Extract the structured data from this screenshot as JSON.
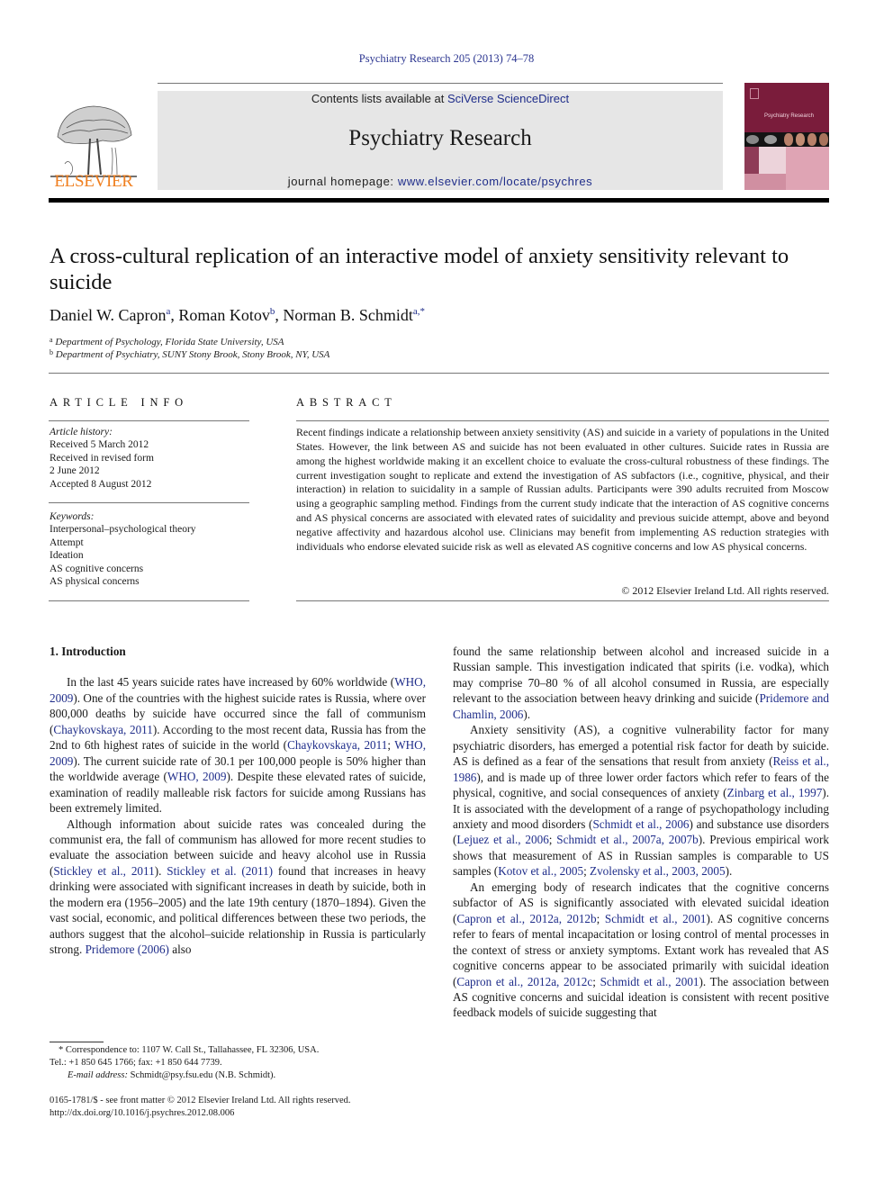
{
  "journal_ref": "Psychiatry Research 205 (2013) 74–78",
  "header": {
    "publisher_logo_text": "ELSEVIER",
    "contents_prefix": "Contents lists available at ",
    "contents_link": "SciVerse ScienceDirect",
    "journal_name": "Psychiatry Research",
    "homepage_prefix": "journal homepage: ",
    "homepage_link": "www.elsevier.com/locate/psychres",
    "cover_title": "Psychiatry Research",
    "colors": {
      "elsevier_orange": "#f07f1f",
      "banner_gray": "#e6e6e6",
      "cover_maroon": "#7a1c3b",
      "link_blue": "#1f2d8a"
    }
  },
  "article": {
    "title": "A cross-cultural replication of an interactive model of anxiety sensitivity relevant to suicide",
    "authors": [
      {
        "name": "Daniel W. Capron",
        "sup": "a"
      },
      {
        "name": "Roman Kotov",
        "sup": "b"
      },
      {
        "name": "Norman B. Schmidt",
        "sup": "a,*"
      }
    ],
    "affiliations": [
      {
        "sup": "a",
        "text": "Department of Psychology, Florida State University, USA"
      },
      {
        "sup": "b",
        "text": "Department of Psychiatry, SUNY Stony Brook, Stony Brook, NY, USA"
      }
    ]
  },
  "article_info": {
    "heading": "ARTICLE INFO",
    "history_label": "Article history:",
    "history": [
      "Received 5 March 2012",
      "Received in revised form",
      "2 June 2012",
      "Accepted 8 August 2012"
    ],
    "keywords_label": "Keywords:",
    "keywords": [
      "Interpersonal–psychological theory",
      "Attempt",
      "Ideation",
      "AS cognitive concerns",
      "AS physical concerns"
    ]
  },
  "abstract": {
    "heading": "ABSTRACT",
    "text": "Recent findings indicate a relationship between anxiety sensitivity (AS) and suicide in a variety of populations in the United States. However, the link between AS and suicide has not been evaluated in other cultures. Suicide rates in Russia are among the highest worldwide making it an excellent choice to evaluate the cross-cultural robustness of these findings. The current investigation sought to replicate and extend the investigation of AS subfactors (i.e., cognitive, physical, and their interaction) in relation to suicidality in a sample of Russian adults. Participants were 390 adults recruited from Moscow using a geographic sampling method. Findings from the current study indicate that the interaction of AS cognitive concerns and AS physical concerns are associated with elevated rates of suicidality and previous suicide attempt, above and beyond negative affectivity and hazardous alcohol use. Clinicians may benefit from implementing AS reduction strategies with individuals who endorse elevated suicide risk as well as elevated AS cognitive concerns and low AS physical concerns.",
    "copyright": "© 2012 Elsevier Ireland Ltd. All rights reserved."
  },
  "body": {
    "section_heading": "1.  Introduction",
    "left_paragraphs": [
      [
        {
          "t": "In the last 45 years suicide rates have increased by 60% worldwide ("
        },
        {
          "t": "WHO, 2009",
          "link": true
        },
        {
          "t": "). One of the countries with the highest suicide rates is Russia, where over 800,000 deaths by suicide have occurred since the fall of communism ("
        },
        {
          "t": "Chaykovskaya, 2011",
          "link": true
        },
        {
          "t": "). According to the most recent data, Russia has from the 2nd to 6th highest rates of suicide in the world ("
        },
        {
          "t": "Chaykovskaya, 2011",
          "link": true
        },
        {
          "t": "; "
        },
        {
          "t": "WHO, 2009",
          "link": true
        },
        {
          "t": "). The current suicide rate of 30.1 per 100,000 people is 50% higher than the worldwide average ("
        },
        {
          "t": "WHO, 2009",
          "link": true
        },
        {
          "t": "). Despite these elevated rates of suicide, examination of readily malleable risk factors for suicide among Russians has been extremely limited."
        }
      ],
      [
        {
          "t": "Although information about suicide rates was concealed during the communist era, the fall of communism has allowed for more recent studies to evaluate the association between suicide and heavy alcohol use in Russia ("
        },
        {
          "t": "Stickley et al., 2011",
          "link": true
        },
        {
          "t": "). "
        },
        {
          "t": "Stickley et al. (2011)",
          "link": true
        },
        {
          "t": " found that increases in heavy drinking were associated with significant increases in death by suicide, both in the modern era (1956–2005) and the late 19th century (1870–1894). Given the vast social, economic, and political differences between these two periods, the authors suggest that the alcohol–suicide relationship in Russia is particularly strong. "
        },
        {
          "t": "Pridemore (2006)",
          "link": true
        },
        {
          "t": " also"
        }
      ]
    ],
    "right_paragraphs": [
      [
        {
          "t": "found the same relationship between alcohol and increased suicide in a Russian sample. This investigation indicated that spirits (i.e. vodka), which may comprise 70–80 % of all alcohol consumed in Russia, are especially relevant to the association between heavy drinking and suicide ("
        },
        {
          "t": "Pridemore and Chamlin, 2006",
          "link": true
        },
        {
          "t": ")."
        }
      ],
      [
        {
          "t": "Anxiety sensitivity (AS), a cognitive vulnerability factor for many psychiatric disorders, has emerged a potential risk factor for death by suicide. AS is defined as a fear of the sensations that result from anxiety ("
        },
        {
          "t": "Reiss et al., 1986",
          "link": true
        },
        {
          "t": "), and is made up of three lower order factors which refer to fears of the physical, cognitive, and social consequences of anxiety ("
        },
        {
          "t": "Zinbarg et al., 1997",
          "link": true
        },
        {
          "t": "). It is associated with the development of a range of psychopathology including anxiety and mood disorders ("
        },
        {
          "t": "Schmidt et al., 2006",
          "link": true
        },
        {
          "t": ") and substance use disorders ("
        },
        {
          "t": "Lejuez et al., 2006",
          "link": true
        },
        {
          "t": "; "
        },
        {
          "t": "Schmidt et al., 2007a, 2007b",
          "link": true
        },
        {
          "t": "). Previous empirical work shows that measurement of AS in Russian samples is comparable to US samples ("
        },
        {
          "t": "Kotov et al., 2005",
          "link": true
        },
        {
          "t": "; "
        },
        {
          "t": "Zvolensky et al., 2003, 2005",
          "link": true
        },
        {
          "t": ")."
        }
      ],
      [
        {
          "t": "An emerging body of research indicates that the cognitive concerns subfactor of AS is significantly associated with elevated suicidal ideation ("
        },
        {
          "t": "Capron et al., 2012a, 2012b",
          "link": true
        },
        {
          "t": "; "
        },
        {
          "t": "Schmidt et al., 2001",
          "link": true
        },
        {
          "t": "). AS cognitive concerns refer to fears of mental incapacitation or losing control of mental processes in the context of stress or anxiety symptoms. Extant work has revealed that AS cognitive concerns appear to be associated primarily with suicidal ideation ("
        },
        {
          "t": "Capron et al., 2012a, 2012c",
          "link": true
        },
        {
          "t": "; "
        },
        {
          "t": "Schmidt et al., 2001",
          "link": true
        },
        {
          "t": "). The association between AS cognitive concerns and suicidal ideation is consistent with recent positive feedback models of suicide suggesting that"
        }
      ]
    ]
  },
  "footnote": {
    "correspondence": "* Correspondence to: 1107 W. Call St., Tallahassee, FL 32306, USA.",
    "tel": "Tel.: +1 850 645 1766; fax: +1 850 644 7739.",
    "email_label": "E-mail address:",
    "email": " Schmidt@psy.fsu.edu (N.B. Schmidt)."
  },
  "front_matter": {
    "issn_line": "0165-1781/$ - see front matter © 2012 Elsevier Ireland Ltd. All rights reserved.",
    "doi": "http://dx.doi.org/10.1016/j.psychres.2012.08.006"
  }
}
